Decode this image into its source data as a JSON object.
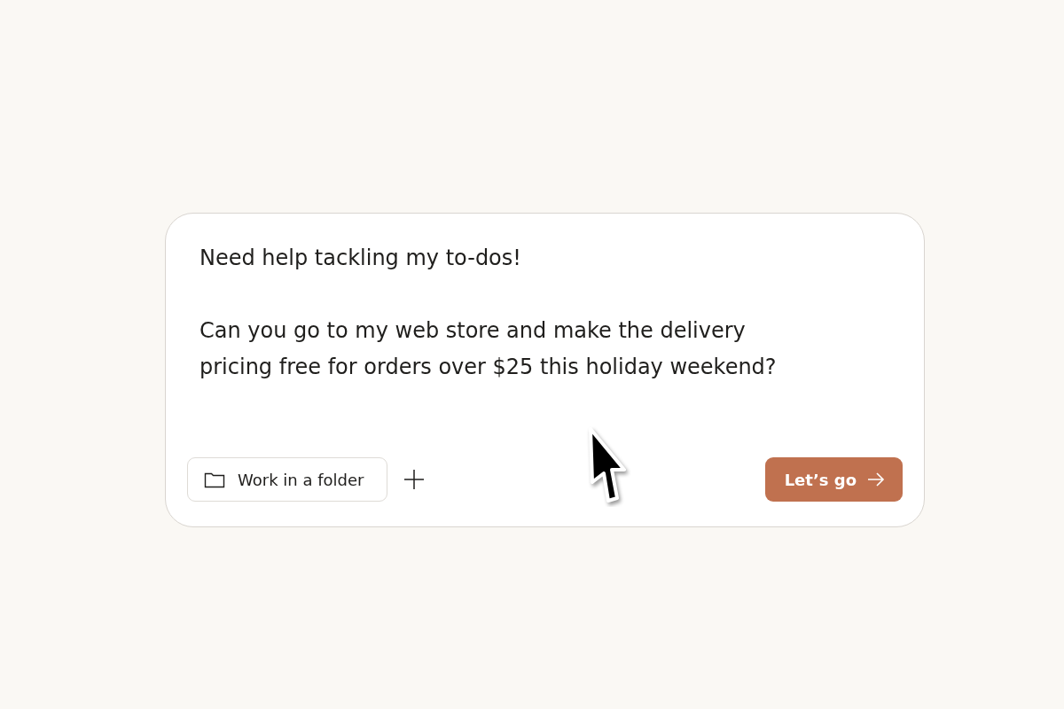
{
  "prompt": {
    "paragraphs": [
      "Need help tackling my to-dos!",
      "Can you go to my web store and make the delivery pricing free for orders over $25 this holiday weekend?"
    ]
  },
  "folder_button": {
    "label": "Work in a folder"
  },
  "submit_button": {
    "label": "Let’s go"
  }
}
